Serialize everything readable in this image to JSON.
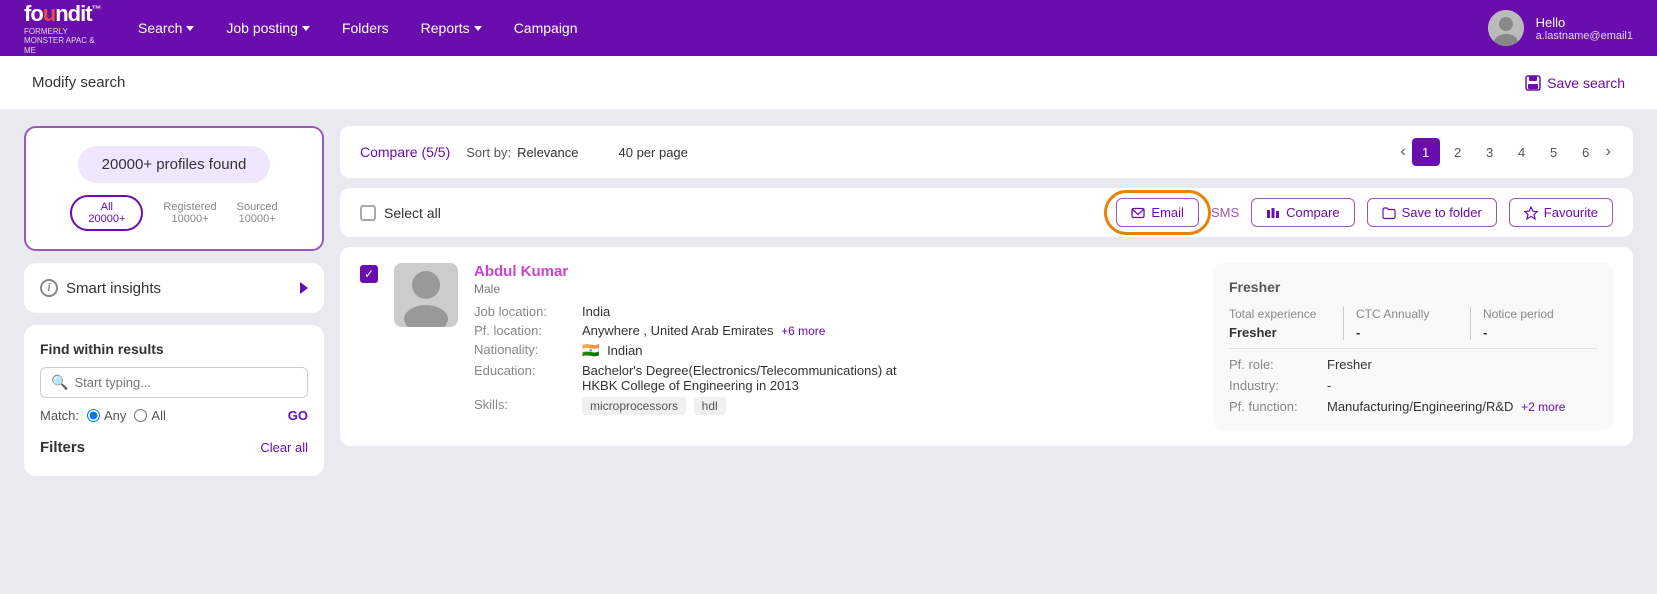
{
  "navbar": {
    "logo": "foundit",
    "logo_sub": "FORMERLY MONSTER APAC & ME",
    "nav_items": [
      {
        "label": "Search",
        "has_dropdown": true
      },
      {
        "label": "Job posting",
        "has_dropdown": true
      },
      {
        "label": "Folders",
        "has_dropdown": false
      },
      {
        "label": "Reports",
        "has_dropdown": true
      },
      {
        "label": "Campaign",
        "has_dropdown": false
      }
    ],
    "hello": "Hello",
    "username": "a.lastname@email1"
  },
  "header": {
    "modify_search": "Modify search",
    "save_search": "Save search"
  },
  "sidebar": {
    "profiles_found": "20000+ profiles found",
    "tabs": [
      {
        "label": "All",
        "count": "20000+",
        "active": true
      },
      {
        "label": "Registered",
        "count": "10000+"
      },
      {
        "label": "Sourced",
        "count": "10000+"
      }
    ],
    "smart_insights": "Smart insights",
    "find_within": "Find within results",
    "search_placeholder": "Start typing...",
    "match_label": "Match:",
    "match_any": "Any",
    "match_all": "All",
    "go_label": "GO",
    "filters_label": "Filters",
    "clear_all": "Clear all"
  },
  "toolbar": {
    "compare_label": "Compare (5/5)",
    "sort_by": "Sort by:",
    "sort_value": "Relevance",
    "per_page": "40 per page",
    "pages": [
      "1",
      "2",
      "3",
      "4",
      "5",
      "6"
    ],
    "active_page": "1"
  },
  "actions": {
    "select_all": "Select all",
    "email": "Email",
    "sms": "SMS",
    "compare": "Compare",
    "save_to_folder": "Save to folder",
    "favourite": "Favourite"
  },
  "candidate": {
    "name": "Abdul Kumar",
    "gender": "Male",
    "job_location_label": "Job location:",
    "job_location": "India",
    "pf_location_label": "Pf. location:",
    "pf_location": "Anywhere , United Arab Emirates",
    "pf_location_more": "+6 more",
    "nationality_label": "Nationality:",
    "nationality": "Indian",
    "education_label": "Education:",
    "education": "Bachelor's Degree(Electronics/Telecommunications) at HKBK College of Engineering in 2013",
    "skills_label": "Skills:",
    "skills": [
      "microprocessors",
      "hdl"
    ]
  },
  "right_panel": {
    "fresher": "Fresher",
    "total_experience_label": "Total experience",
    "ctc_annually_label": "CTC Annually",
    "notice_period_label": "Notice period",
    "total_experience_val": "Fresher",
    "ctc_annually_val": "-",
    "notice_period_val": "-",
    "pf_role_label": "Pf. role:",
    "pf_role_val": "Fresher",
    "industry_label": "Industry:",
    "industry_val": "-",
    "pf_function_label": "Pf. function:",
    "pf_function_val": "Manufacturing/Engineering/R&D",
    "pf_function_more": "+2 more"
  }
}
